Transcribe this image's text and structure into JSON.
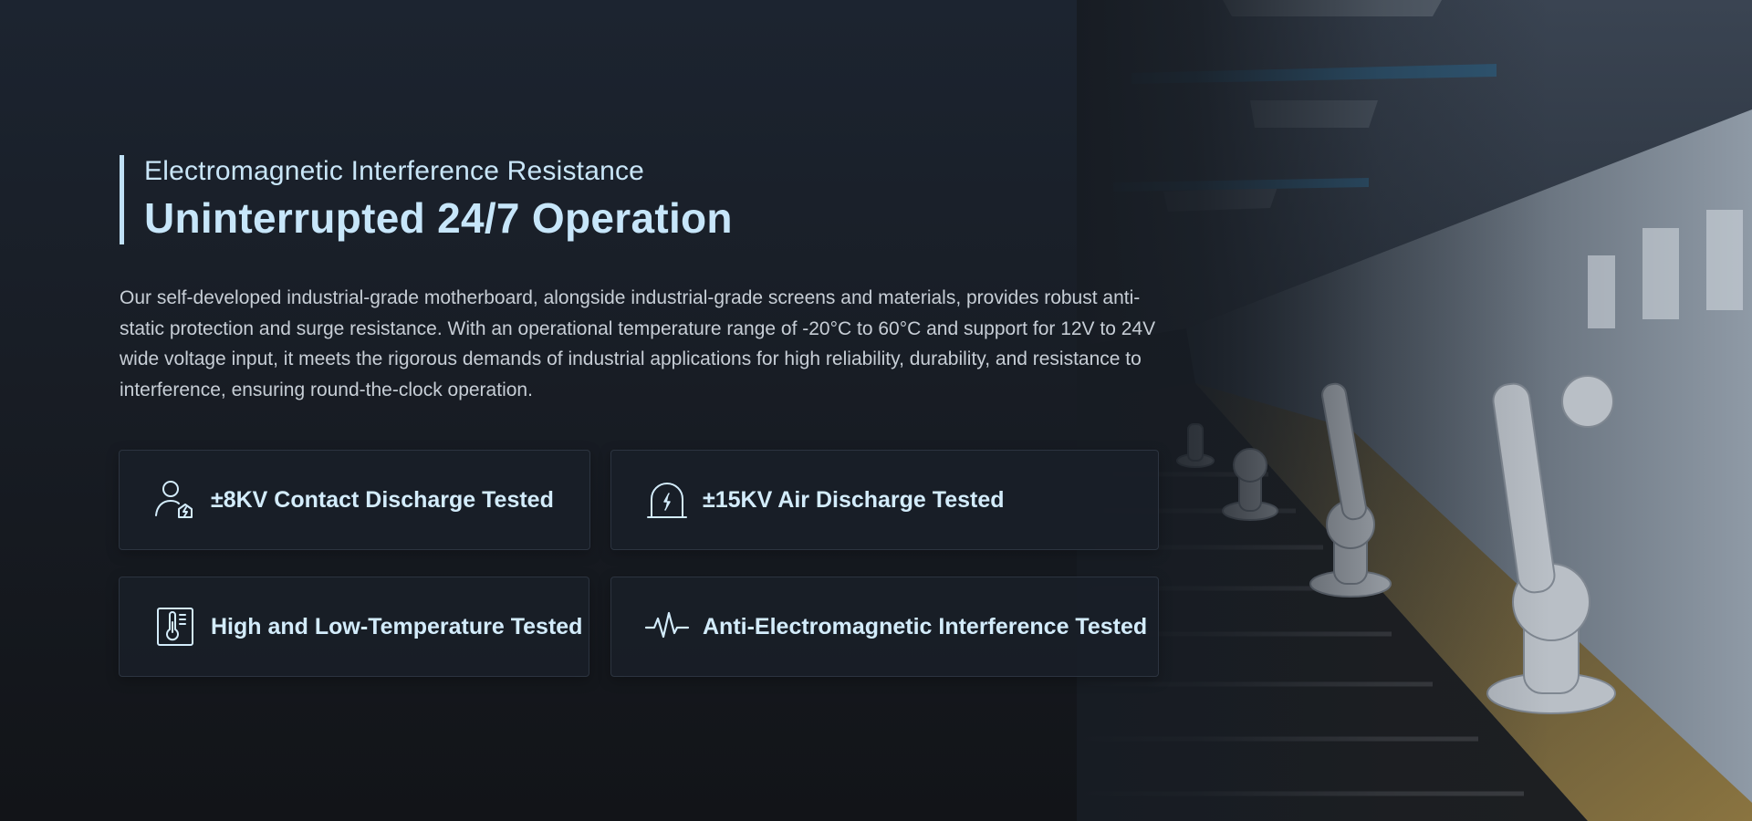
{
  "section": {
    "eyebrow": "Electromagnetic Interference Resistance",
    "title": "Uninterrupted 24/7 Operation",
    "description": "Our self-developed industrial-grade motherboard, alongside industrial-grade screens and materials, provides robust anti-static protection and surge resistance. With an operational temperature range of -20°C to 60°C and support for 12V to 24V wide voltage input, it meets the rigorous demands of industrial applications for high reliability, durability, and resistance to interference, ensuring round-the-clock operation."
  },
  "features": [
    {
      "label": "±8KV Contact Discharge Tested",
      "icon": "person-discharge-icon"
    },
    {
      "label": "±15KV Air Discharge Tested",
      "icon": "air-discharge-icon"
    },
    {
      "label": "High and Low-Temperature Tested",
      "icon": "thermometer-icon"
    },
    {
      "label": "Anti-Electromagnetic Interference Tested",
      "icon": "waveform-icon"
    }
  ],
  "colors": {
    "accent": "#c7e6fa",
    "card_background": "#191f28",
    "page_background": "#14181e"
  }
}
